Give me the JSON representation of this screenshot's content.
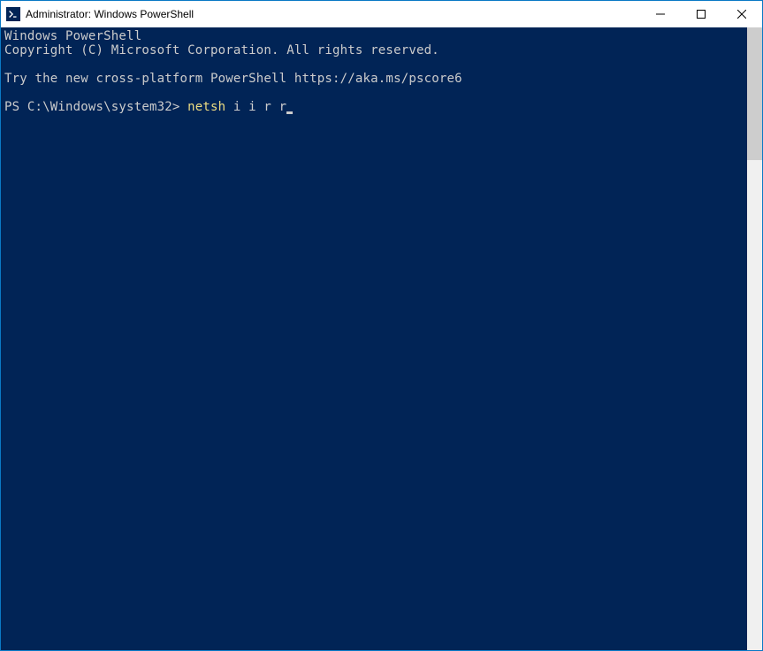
{
  "window": {
    "title": "Administrator: Windows PowerShell"
  },
  "terminal": {
    "banner_line1": "Windows PowerShell",
    "banner_line2": "Copyright (C) Microsoft Corporation. All rights reserved.",
    "try_line": "Try the new cross-platform PowerShell https://aka.ms/pscore6",
    "prompt_prefix": "PS C:\\Windows\\system32> ",
    "command_head": "netsh ",
    "command_rest": "i i r r"
  },
  "colors": {
    "terminal_bg": "#012456",
    "terminal_fg": "#cccccc",
    "command_fg": "#eedd82",
    "border": "#0a79c5"
  },
  "icons": {
    "app": "powershell-icon",
    "minimize": "minimize-icon",
    "maximize": "maximize-icon",
    "close": "close-icon"
  }
}
